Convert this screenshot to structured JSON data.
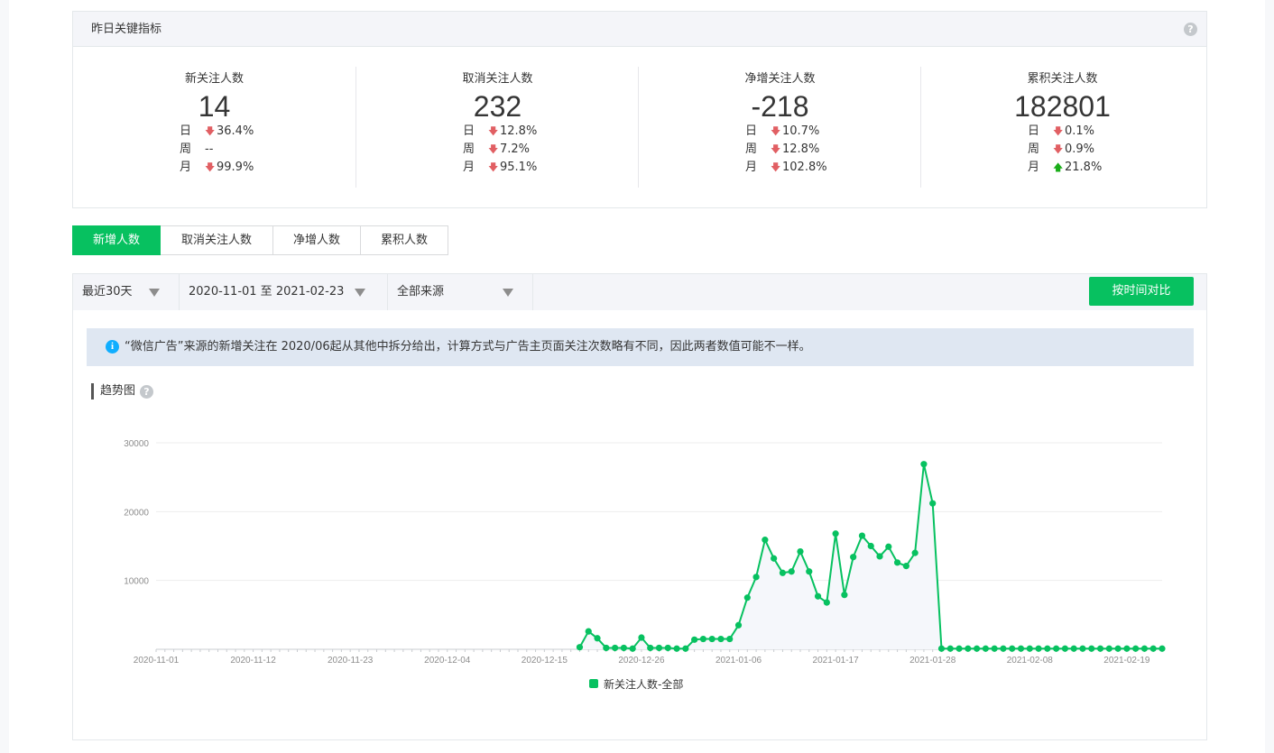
{
  "kpi": {
    "title": "昨日关键指标",
    "items": [
      {
        "name": "新关注人数",
        "value": "14",
        "rows": [
          {
            "label": "日",
            "dir": "down",
            "value": "36.4%"
          },
          {
            "label": "周",
            "dir": "none",
            "value": "--"
          },
          {
            "label": "月",
            "dir": "down",
            "value": "99.9%"
          }
        ]
      },
      {
        "name": "取消关注人数",
        "value": "232",
        "rows": [
          {
            "label": "日",
            "dir": "down",
            "value": "12.8%"
          },
          {
            "label": "周",
            "dir": "down",
            "value": "7.2%"
          },
          {
            "label": "月",
            "dir": "down",
            "value": "95.1%"
          }
        ]
      },
      {
        "name": "净增关注人数",
        "value": "-218",
        "rows": [
          {
            "label": "日",
            "dir": "down",
            "value": "10.7%"
          },
          {
            "label": "周",
            "dir": "down",
            "value": "12.8%"
          },
          {
            "label": "月",
            "dir": "down",
            "value": "102.8%"
          }
        ]
      },
      {
        "name": "累积关注人数",
        "value": "182801",
        "rows": [
          {
            "label": "日",
            "dir": "down",
            "value": "0.1%"
          },
          {
            "label": "周",
            "dir": "down",
            "value": "0.9%"
          },
          {
            "label": "月",
            "dir": "up",
            "value": "21.8%"
          }
        ]
      }
    ]
  },
  "tabs": [
    "新增人数",
    "取消关注人数",
    "净增人数",
    "累积人数"
  ],
  "active_tab": 0,
  "filters": {
    "range": "最近30天",
    "dates": "2020-11-01 至 2021-02-23",
    "source": "全部来源",
    "compare": "按时间对比"
  },
  "notice": "“微信广告”来源的新增关注在 2020/06起从其他中拆分给出，计算方式与广告主页面关注次数略有不同，因此两者数值可能不一样。",
  "section_title": "趋势图",
  "icons": {
    "help": "question-circle-icon",
    "info": "info-circle-icon",
    "caret": "caret-down-icon",
    "arrow_down": "arrow-down-icon",
    "arrow_up": "arrow-up-icon"
  },
  "colors": {
    "accent": "#07c160",
    "down": "#e15f63",
    "up": "#1aad19",
    "info": "#10aeff"
  },
  "chart_data": {
    "type": "line",
    "title": "",
    "xlabel": "",
    "ylabel": "",
    "ylim": [
      0,
      30000
    ],
    "y_ticks": [
      10000,
      20000,
      30000
    ],
    "x_start": "2020-11-01",
    "x_end": "2021-02-23",
    "x_ticks": [
      "2020-11-01",
      "2020-11-12",
      "2020-11-23",
      "2020-12-04",
      "2020-12-15",
      "2020-12-26",
      "2021-01-06",
      "2021-01-17",
      "2021-01-28",
      "2021-02-08",
      "2021-02-19"
    ],
    "legend": "bottom-center",
    "grid": true,
    "series": [
      {
        "name": "新关注人数-全部",
        "color": "#07c160",
        "points": [
          [
            "2020-12-19",
            300
          ],
          [
            "2020-12-20",
            2600
          ],
          [
            "2020-12-21",
            1600
          ],
          [
            "2020-12-22",
            200
          ],
          [
            "2020-12-23",
            200
          ],
          [
            "2020-12-24",
            200
          ],
          [
            "2020-12-25",
            100
          ],
          [
            "2020-12-26",
            1700
          ],
          [
            "2020-12-27",
            200
          ],
          [
            "2020-12-28",
            200
          ],
          [
            "2020-12-29",
            200
          ],
          [
            "2020-12-30",
            100
          ],
          [
            "2020-12-31",
            100
          ],
          [
            "2021-01-01",
            1400
          ],
          [
            "2021-01-02",
            1500
          ],
          [
            "2021-01-03",
            1500
          ],
          [
            "2021-01-04",
            1500
          ],
          [
            "2021-01-05",
            1500
          ],
          [
            "2021-01-06",
            3500
          ],
          [
            "2021-01-07",
            7500
          ],
          [
            "2021-01-08",
            10500
          ],
          [
            "2021-01-09",
            15900
          ],
          [
            "2021-01-10",
            13200
          ],
          [
            "2021-01-11",
            11100
          ],
          [
            "2021-01-12",
            11300
          ],
          [
            "2021-01-13",
            14200
          ],
          [
            "2021-01-14",
            11300
          ],
          [
            "2021-01-15",
            7700
          ],
          [
            "2021-01-16",
            6800
          ],
          [
            "2021-01-17",
            16800
          ],
          [
            "2021-01-18",
            7900
          ],
          [
            "2021-01-19",
            13400
          ],
          [
            "2021-01-20",
            16500
          ],
          [
            "2021-01-21",
            15000
          ],
          [
            "2021-01-22",
            13500
          ],
          [
            "2021-01-23",
            14900
          ],
          [
            "2021-01-24",
            12600
          ],
          [
            "2021-01-25",
            12100
          ],
          [
            "2021-01-26",
            14000
          ],
          [
            "2021-01-27",
            26900
          ],
          [
            "2021-01-28",
            21200
          ],
          [
            "2021-01-29",
            100
          ],
          [
            "2021-01-30",
            100
          ],
          [
            "2021-01-31",
            100
          ],
          [
            "2021-02-01",
            100
          ],
          [
            "2021-02-02",
            100
          ],
          [
            "2021-02-03",
            100
          ],
          [
            "2021-02-04",
            100
          ],
          [
            "2021-02-05",
            100
          ],
          [
            "2021-02-06",
            100
          ],
          [
            "2021-02-07",
            100
          ],
          [
            "2021-02-08",
            100
          ],
          [
            "2021-02-09",
            100
          ],
          [
            "2021-02-10",
            100
          ],
          [
            "2021-02-11",
            100
          ],
          [
            "2021-02-12",
            100
          ],
          [
            "2021-02-13",
            100
          ],
          [
            "2021-02-14",
            100
          ],
          [
            "2021-02-15",
            100
          ],
          [
            "2021-02-16",
            100
          ],
          [
            "2021-02-17",
            100
          ],
          [
            "2021-02-18",
            100
          ],
          [
            "2021-02-19",
            100
          ],
          [
            "2021-02-20",
            100
          ],
          [
            "2021-02-21",
            100
          ],
          [
            "2021-02-22",
            100
          ],
          [
            "2021-02-23",
            100
          ]
        ]
      }
    ]
  }
}
